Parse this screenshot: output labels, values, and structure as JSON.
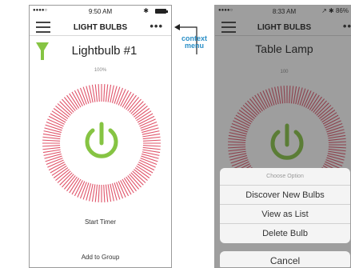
{
  "left": {
    "status": {
      "signal": "●●●●○",
      "time": "9:50 AM",
      "bluetooth": "✱"
    },
    "nav": {
      "title": "LIGHT BULBS",
      "more": "•••"
    },
    "bulb_name": "Lightbulb #1",
    "brightness": "100%",
    "brightness_value": 100,
    "start_timer": "Start Timer",
    "add_to_group": "Add to Group"
  },
  "annotation": {
    "line1": "context",
    "line2": "menu"
  },
  "right": {
    "status": {
      "signal": "●●●●○",
      "time": "8:33 AM",
      "right": "↗ ✱ 86%"
    },
    "nav": {
      "title": "LIGHT BULBS",
      "more": "••"
    },
    "bulb_name": "Table Lamp",
    "brightness": "100",
    "sheet": {
      "header": "Choose Option",
      "items": [
        "Discover New Bulbs",
        "View as List",
        "Delete Bulb"
      ],
      "cancel": "Cancel"
    }
  },
  "colors": {
    "ring": "#e0546a",
    "power": "#86c443",
    "accent_blue": "#2a8fc7"
  }
}
